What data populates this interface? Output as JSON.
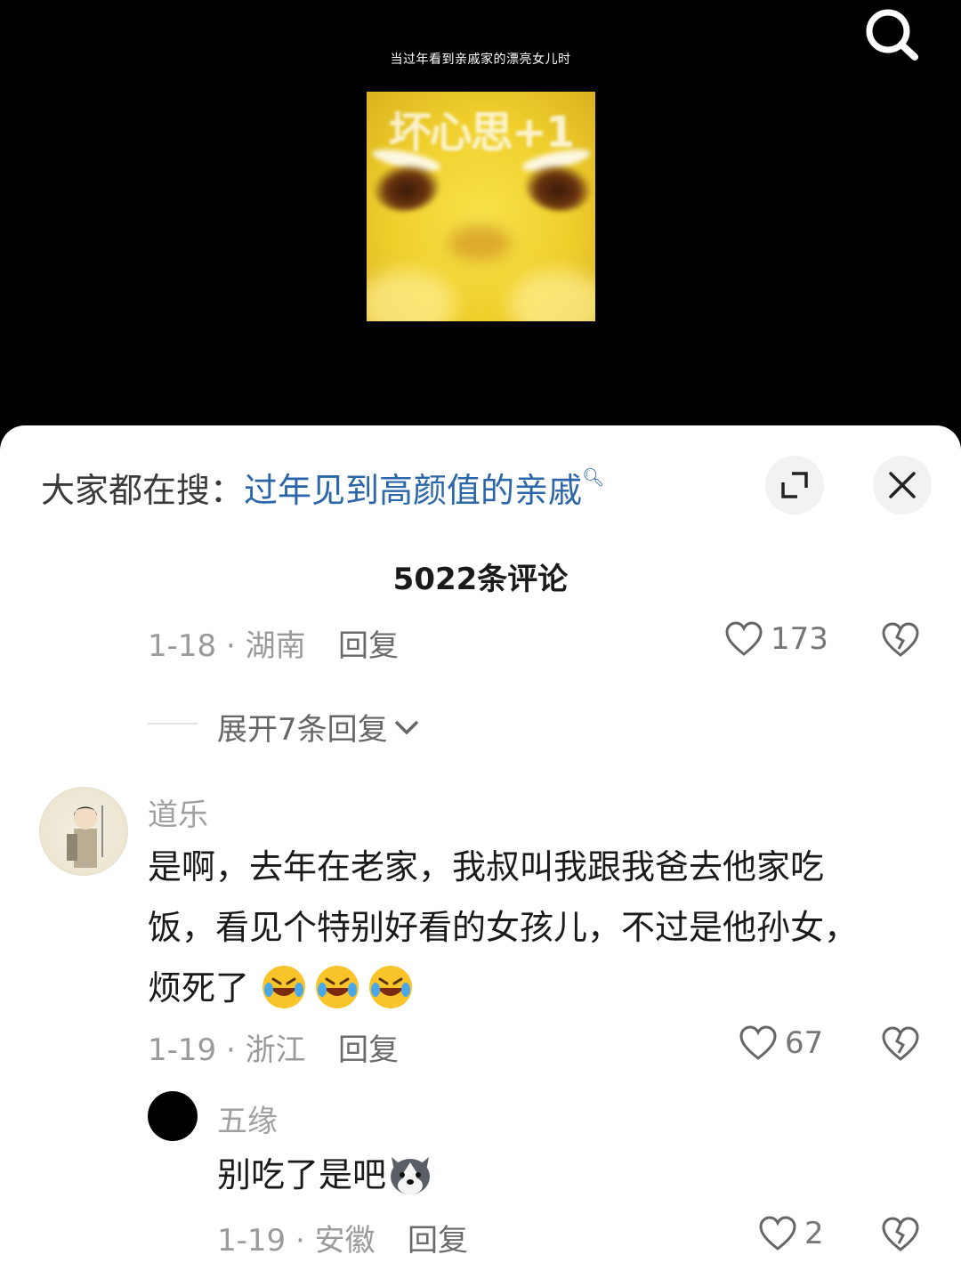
{
  "video": {
    "caption": "当过年看到亲戚家的漂亮女儿时",
    "meme_text": "坏心思+1"
  },
  "sheet": {
    "trending_prefix": "大家都在搜：",
    "trending_query": "过年见到高颜值的亲戚",
    "comment_count": "5022条评论"
  },
  "comments": [
    {
      "date_location": "1-18 · 湖南",
      "reply_label": "回复",
      "likes": "173",
      "expand_replies": "展开7条回复"
    },
    {
      "username": "道乐",
      "text_lines": [
        "是啊，去年在老家，我叔叫我跟我爸去他家吃",
        "饭，看见个特别好看的女孩儿，不过是他孙女，",
        "烦死了"
      ],
      "emoji": "rolling-laughing-emoji",
      "date_location": "1-19 · 浙江",
      "reply_label": "回复",
      "likes": "67"
    },
    {
      "username": "五缘",
      "text": "别吃了是吧",
      "emoji": "husky-dog-emoji",
      "date_location": "1-19 · 安徽",
      "reply_label": "回复",
      "likes": "2"
    }
  ],
  "icons": {
    "search": "search-icon",
    "expand": "expand-icon",
    "close": "close-icon",
    "like": "heart-icon",
    "dislike": "broken-heart-icon",
    "chevron": "chevron-down-icon"
  },
  "colors": {
    "link": "#2a66a8",
    "background_video": "#000000",
    "sheet": "#ffffff"
  }
}
